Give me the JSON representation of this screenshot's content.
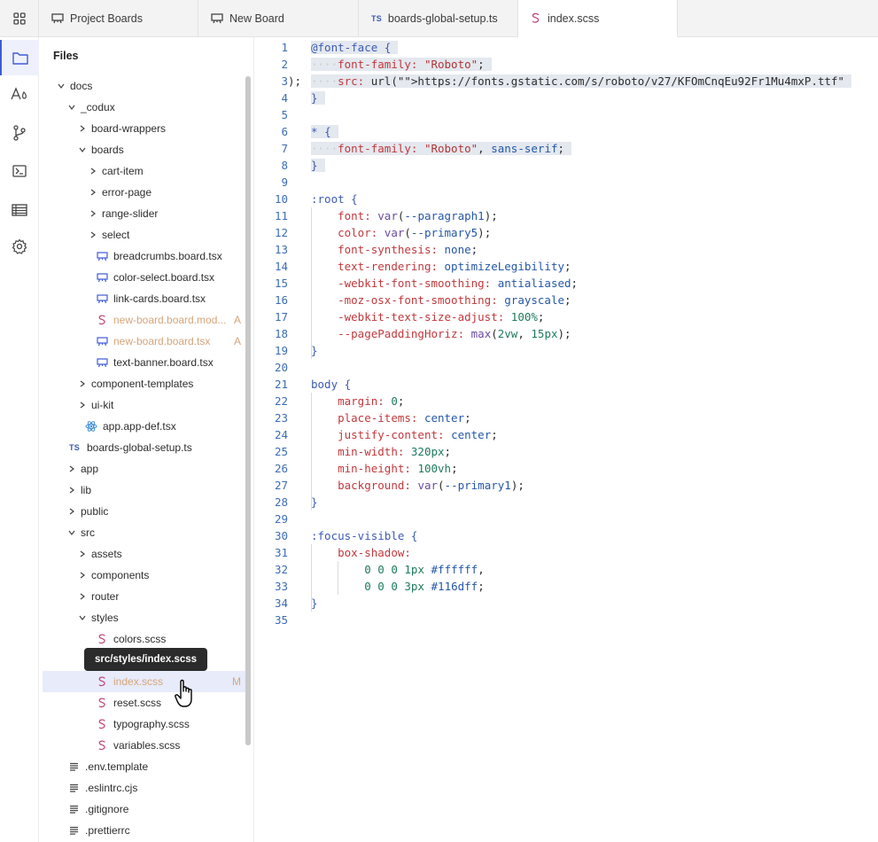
{
  "tabs": [
    {
      "label": "Project Boards",
      "icon": "board-icon",
      "active": false
    },
    {
      "label": "New Board",
      "icon": "board-icon",
      "active": false
    },
    {
      "label": "boards-global-setup.ts",
      "icon": "ts-icon",
      "active": false
    },
    {
      "label": "index.scss",
      "icon": "scss-icon",
      "active": true
    }
  ],
  "ts_badge": "TS",
  "activity": [
    "files-icon",
    "typography-icon",
    "git-branch-icon",
    "terminal-icon",
    "table-icon",
    "settings-icon"
  ],
  "sidebar": {
    "title": "Files",
    "tooltip": "src/styles/index.scss",
    "rows": [
      {
        "label": "docs",
        "depth": 0,
        "type": "folder-open"
      },
      {
        "label": "_codux",
        "depth": 1,
        "type": "folder-open"
      },
      {
        "label": "board-wrappers",
        "depth": 2,
        "type": "folder"
      },
      {
        "label": "boards",
        "depth": 2,
        "type": "folder-open"
      },
      {
        "label": "cart-item",
        "depth": 3,
        "type": "folder"
      },
      {
        "label": "error-page",
        "depth": 3,
        "type": "folder"
      },
      {
        "label": "range-slider",
        "depth": 3,
        "type": "folder"
      },
      {
        "label": "select",
        "depth": 3,
        "type": "folder"
      },
      {
        "label": "breadcrumbs.board.tsx",
        "depth": 3,
        "type": "board"
      },
      {
        "label": "color-select.board.tsx",
        "depth": 3,
        "type": "board"
      },
      {
        "label": "link-cards.board.tsx",
        "depth": 3,
        "type": "board"
      },
      {
        "label": "new-board.board.mod...",
        "depth": 3,
        "type": "scss",
        "status": "A",
        "modified": true
      },
      {
        "label": "new-board.board.tsx",
        "depth": 3,
        "type": "board",
        "status": "A",
        "modified": true
      },
      {
        "label": "text-banner.board.tsx",
        "depth": 3,
        "type": "board"
      },
      {
        "label": "component-templates",
        "depth": 2,
        "type": "folder"
      },
      {
        "label": "ui-kit",
        "depth": 2,
        "type": "folder"
      },
      {
        "label": "app.app-def.tsx",
        "depth": 2,
        "type": "react"
      },
      {
        "label": "boards-global-setup.ts",
        "depth": 1,
        "type": "ts"
      },
      {
        "label": "app",
        "depth": 1,
        "type": "folder"
      },
      {
        "label": "lib",
        "depth": 1,
        "type": "folder"
      },
      {
        "label": "public",
        "depth": 1,
        "type": "folder"
      },
      {
        "label": "src",
        "depth": 1,
        "type": "folder-open"
      },
      {
        "label": "assets",
        "depth": 2,
        "type": "folder"
      },
      {
        "label": "components",
        "depth": 2,
        "type": "folder"
      },
      {
        "label": "router",
        "depth": 2,
        "type": "folder"
      },
      {
        "label": "styles",
        "depth": 2,
        "type": "folder-open"
      },
      {
        "label": "colors.scss",
        "depth": 3,
        "type": "scss"
      },
      {
        "label": "",
        "depth": 3,
        "type": "hidden"
      },
      {
        "label": "index.scss",
        "depth": 3,
        "type": "scss",
        "status": "M",
        "modified": true,
        "selected": true
      },
      {
        "label": "reset.scss",
        "depth": 3,
        "type": "scss"
      },
      {
        "label": "typography.scss",
        "depth": 3,
        "type": "scss"
      },
      {
        "label": "variables.scss",
        "depth": 3,
        "type": "scss"
      },
      {
        "label": ".env.template",
        "depth": 1,
        "type": "lines"
      },
      {
        "label": ".eslintrc.cjs",
        "depth": 1,
        "type": "lines"
      },
      {
        "label": ".gitignore",
        "depth": 1,
        "type": "lines"
      },
      {
        "label": ".prettierrc",
        "depth": 1,
        "type": "lines"
      }
    ]
  },
  "editor": {
    "file": "index.scss",
    "lines": [
      "@font-face {",
      "    font-family: \"Roboto\";",
      "    src: url(\"https://fonts.gstatic.com/s/roboto/v27/KFOmCnqEu92Fr1Mu4mxP.ttf\");",
      "}",
      "",
      "* {",
      "    font-family: \"Roboto\", sans-serif;",
      "}",
      "",
      ":root {",
      "    font: var(--paragraph1);",
      "    color: var(--primary5);",
      "    font-synthesis: none;",
      "    text-rendering: optimizeLegibility;",
      "    -webkit-font-smoothing: antialiased;",
      "    -moz-osx-font-smoothing: grayscale;",
      "    -webkit-text-size-adjust: 100%;",
      "    --pagePaddingHoriz: max(2vw, 15px);",
      "}",
      "",
      "body {",
      "    margin: 0;",
      "    place-items: center;",
      "    justify-content: center;",
      "    min-width: 320px;",
      "    min-height: 100vh;",
      "    background: var(--primary1);",
      "}",
      "",
      ":focus-visible {",
      "    box-shadow:",
      "        0 0 0 1px #ffffff,",
      "        0 0 0 3px #116dff;",
      "}",
      ""
    ]
  }
}
